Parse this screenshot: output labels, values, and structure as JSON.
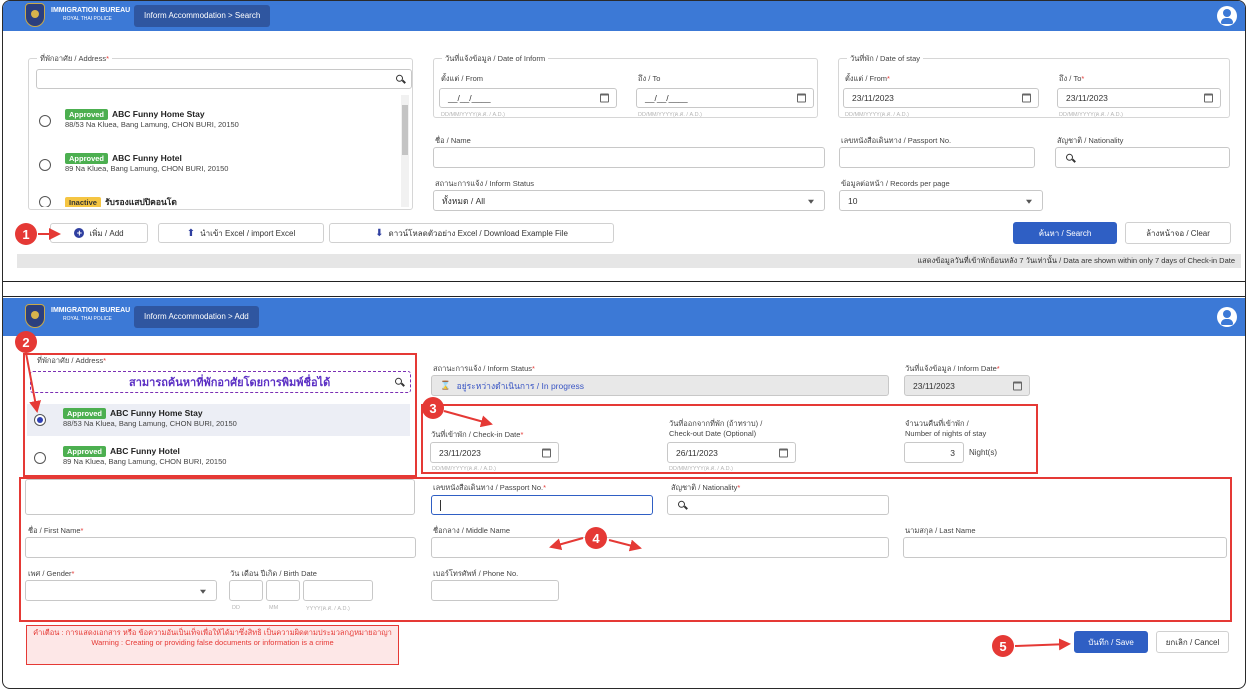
{
  "search": {
    "logo_line1": "IMMIGRATION BUREAU",
    "logo_line2": "ROYAL THAI POLICE",
    "breadcrumb": "Inform Accommodation > Search",
    "address_legend": "ที่พักอาศัย / Address",
    "address_items": [
      {
        "status": "Approved",
        "name": "ABC Funny Home Stay",
        "address": "88/53 Na Kluea, Bang Lamung, CHON BURI, 20150"
      },
      {
        "status": "Approved",
        "name": "ABC Funny Hotel",
        "address": "89 Na Kluea, Bang Lamung, CHON BURI, 20150"
      },
      {
        "status": "Inactive",
        "name": "รับรองแสปปิคอนโด",
        "address": ""
      }
    ],
    "date_inform_legend": "วันที่แจ้งข้อมูล / Date of Inform",
    "from_label": "ตั้งแต่ / From",
    "to_label": "ถึง / To",
    "date_placeholder": "__/__/____",
    "date_hint": "DD/MM/YYYY(ค.ศ. / A.D.)",
    "date_stay_legend": "วันที่พัก / Date of stay",
    "stay_from_value": "23/11/2023",
    "stay_to_value": "23/11/2023",
    "name_label": "ชื่อ / Name",
    "passport_label": "เลขหนังสือเดินทาง / Passport No.",
    "nationality_label": "สัญชาติ / Nationality",
    "inform_status_label": "สถานะการแจ้ง / Inform Status",
    "inform_status_value": "ทั้งหมด / All",
    "records_label": "ข้อมูลต่อหน้า / Records per page",
    "records_value": "10",
    "add_button": "เพิ่ม / Add",
    "import_button": "นำเข้า Excel / import Excel",
    "download_button": "ดาวน์โหลดตัวอย่าง Excel / Download Example File",
    "search_button": "ค้นหา / Search",
    "clear_button": "ล้างหน้าจอ / Clear",
    "info_text": "แสดงข้อมูลวันที่เข้าพักย้อนหลัง 7 วันเท่านั้น / Data are shown within only 7 days of Check-in Date"
  },
  "add": {
    "breadcrumb": "Inform Accommodation > Add",
    "address_legend": "ที่พักอาศัย / Address",
    "address_search_value": "สามารถค้นหาที่พักอาศัยโดยการพิมพ์ชื่อได้",
    "address_items": [
      {
        "status": "Approved",
        "name": "ABC Funny Home Stay",
        "address": "88/53 Na Kluea, Bang Lamung, CHON BURI, 20150",
        "selected": true
      },
      {
        "status": "Approved",
        "name": "ABC Funny Hotel",
        "address": "89 Na Kluea, Bang Lamung, CHON BURI, 20150",
        "selected": false
      }
    ],
    "inform_status_label": "สถานะการแจ้ง / Inform Status",
    "inform_status_value": "อยู่ระหว่างดำเนินการ / In progress",
    "inform_date_label": "วันที่แจ้งข้อมูล / Inform Date",
    "inform_date_value": "23/11/2023",
    "checkin_label": "วันที่เข้าพัก / Check-in Date",
    "checkin_value": "23/11/2023",
    "checkout_label_1": "วันที่ออกจากที่พัก (ถ้าทราบ) /",
    "checkout_label_2": "Check-out Date (Optional)",
    "checkout_value": "26/11/2023",
    "nights_label_1": "จำนวนคืนที่เข้าพัก /",
    "nights_label_2": "Number of nights of stay",
    "nights_value": "3",
    "nights_unit": "Night(s)",
    "date_hint": "DD/MM/YYYY(ค.ศ. / A.D.)",
    "passport_label": "เลขหนังสือเดินทาง / Passport No.",
    "nationality_label": "สัญชาติ / Nationality",
    "first_name_label": "ชื่อ / First Name",
    "middle_name_label": "ชื่อกลาง / Middle Name",
    "last_name_label": "นามสกุล / Last Name",
    "gender_label": "เพศ / Gender",
    "birth_label": "วัน เดือน ปีเกิด / Birth Date",
    "birth_hint_dd": "DD",
    "birth_hint_mm": "MM",
    "birth_hint_yyyy": "YYYY(ค.ศ. / A.D.)",
    "phone_label": "เบอร์โทรศัพท์ / Phone No.",
    "warning_th": "คำเตือน : การแสดงเอกสาร หรือ ข้อความอันเป็นเท็จเพื่อให้ได้มาซึ่งสิทธิ เป็นความผิดตามประมวลกฎหมายอาญา",
    "warning_en": "Warning : Creating or providing false documents or information is a crime",
    "save_button": "บันทึก / Save",
    "cancel_button": "ยกเลิก / Cancel"
  },
  "markers": [
    "1",
    "2",
    "3",
    "4",
    "5"
  ],
  "colors": {
    "header": "#3c79d6",
    "primary_button": "#2f5fc4",
    "approved": "#4caf50",
    "inactive": "#f5c542",
    "annotation": "#e53935"
  }
}
